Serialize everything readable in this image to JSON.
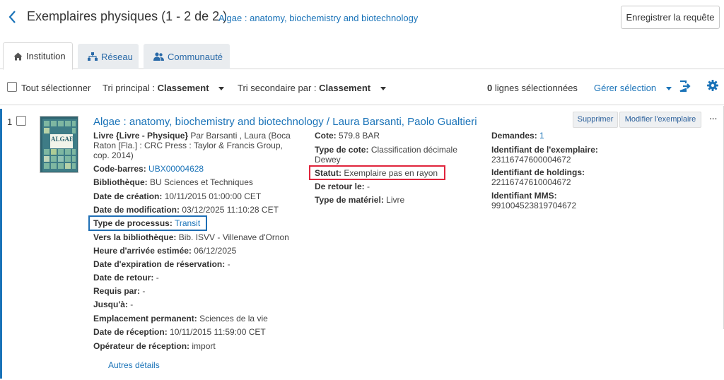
{
  "header": {
    "title": "Exemplaires physiques (1 - 2 de 2 )",
    "title_link": "Algae : anatomy, biochemistry and biotechnology",
    "save_query_label": "Enregistrer la requête"
  },
  "tabs": [
    {
      "label": "Institution",
      "icon": "home-icon",
      "active": true
    },
    {
      "label": "Réseau",
      "icon": "network-icon",
      "active": false
    },
    {
      "label": "Communauté",
      "icon": "community-icon",
      "active": false
    }
  ],
  "toolbar": {
    "select_all_label": "Tout sélectionner",
    "primary_sort_label": "Tri principal :",
    "primary_sort_value": "Classement",
    "secondary_sort_label": "Tri secondaire par :",
    "secondary_sort_value": "Classement",
    "selected_count": "0",
    "selected_label": "lignes sélectionnées",
    "manage_selection_label": "Gérer sélection"
  },
  "record": {
    "row_number": "1",
    "title": "Algae : anatomy, biochemistry and biotechnology / Laura Barsanti, Paolo Gualtieri",
    "thumbnail_text": "ALGAE",
    "delete_label": "Supprimer",
    "edit_label": "Modifier l'exemplaire",
    "more_label": "···",
    "more_details_label": "Autres détails",
    "col1": {
      "type_key": "Livre {Livre - Physique}",
      "type_value_line1": " Par Barsanti , Laura (Boca",
      "type_value_line2": "Raton [Fla.] : CRC Press : Taylor & Francis Group,",
      "type_value_line3": "cop. 2014)",
      "barcode_key": "Code-barres:",
      "barcode_value": "UBX00004628",
      "library_key": "Bibliothèque:",
      "library_value": "BU Sciences et Techniques",
      "created_key": "Date de création:",
      "created_value": "10/11/2015 01:00:00 CET",
      "modified_key": "Date de modification:",
      "modified_value": "03/12/2025 11:10:28 CET",
      "process_key": "Type de processus:",
      "process_value": "Transit",
      "to_library_key": "Vers la bibliothèque:",
      "to_library_value": "Bib. ISVV - Villenave d'Ornon",
      "eta_key": "Heure d'arrivée estimée:",
      "eta_value": "06/12/2025",
      "hold_exp_key": "Date d'expiration de réservation:",
      "hold_exp_value": "-",
      "return_date_key": "Date de retour:",
      "return_date_value": "-",
      "requested_by_key": "Requis par:",
      "requested_by_value": "-",
      "until_key": "Jusqu'à:",
      "until_value": "-",
      "perm_location_key": "Emplacement permanent:",
      "perm_location_value": "Sciences de la vie",
      "received_key": "Date de réception:",
      "received_value": "10/11/2015 11:59:00 CET",
      "operator_key": "Opérateur de réception:",
      "operator_value": "import"
    },
    "col2": {
      "callno_key": "Cote:",
      "callno_value": "579.8 BAR",
      "callno_type_key": "Type de cote:",
      "callno_type_value_line1": "Classification décimale",
      "callno_type_value_line2": "Dewey",
      "status_key": "Statut:",
      "status_value": "Exemplaire pas en rayon",
      "back_key": "De retour le:",
      "back_value": "-",
      "material_key": "Type de matériel:",
      "material_value": "Livre"
    },
    "col3": {
      "requests_key": "Demandes:",
      "requests_value": "1",
      "item_id_key": "Identifiant de l'exemplaire:",
      "item_id_value": "23116747600004672",
      "holdings_id_key": "Identifiant de holdings:",
      "holdings_id_value": "22116747610004672",
      "mms_id_key": "Identifiant MMS:",
      "mms_id_value": "991004523819704672"
    }
  },
  "colors": {
    "link": "#1a73b8",
    "highlight_blue": "#1f6fb5",
    "highlight_red": "#e0243c",
    "tab_inactive_bg": "#e9ecef"
  }
}
